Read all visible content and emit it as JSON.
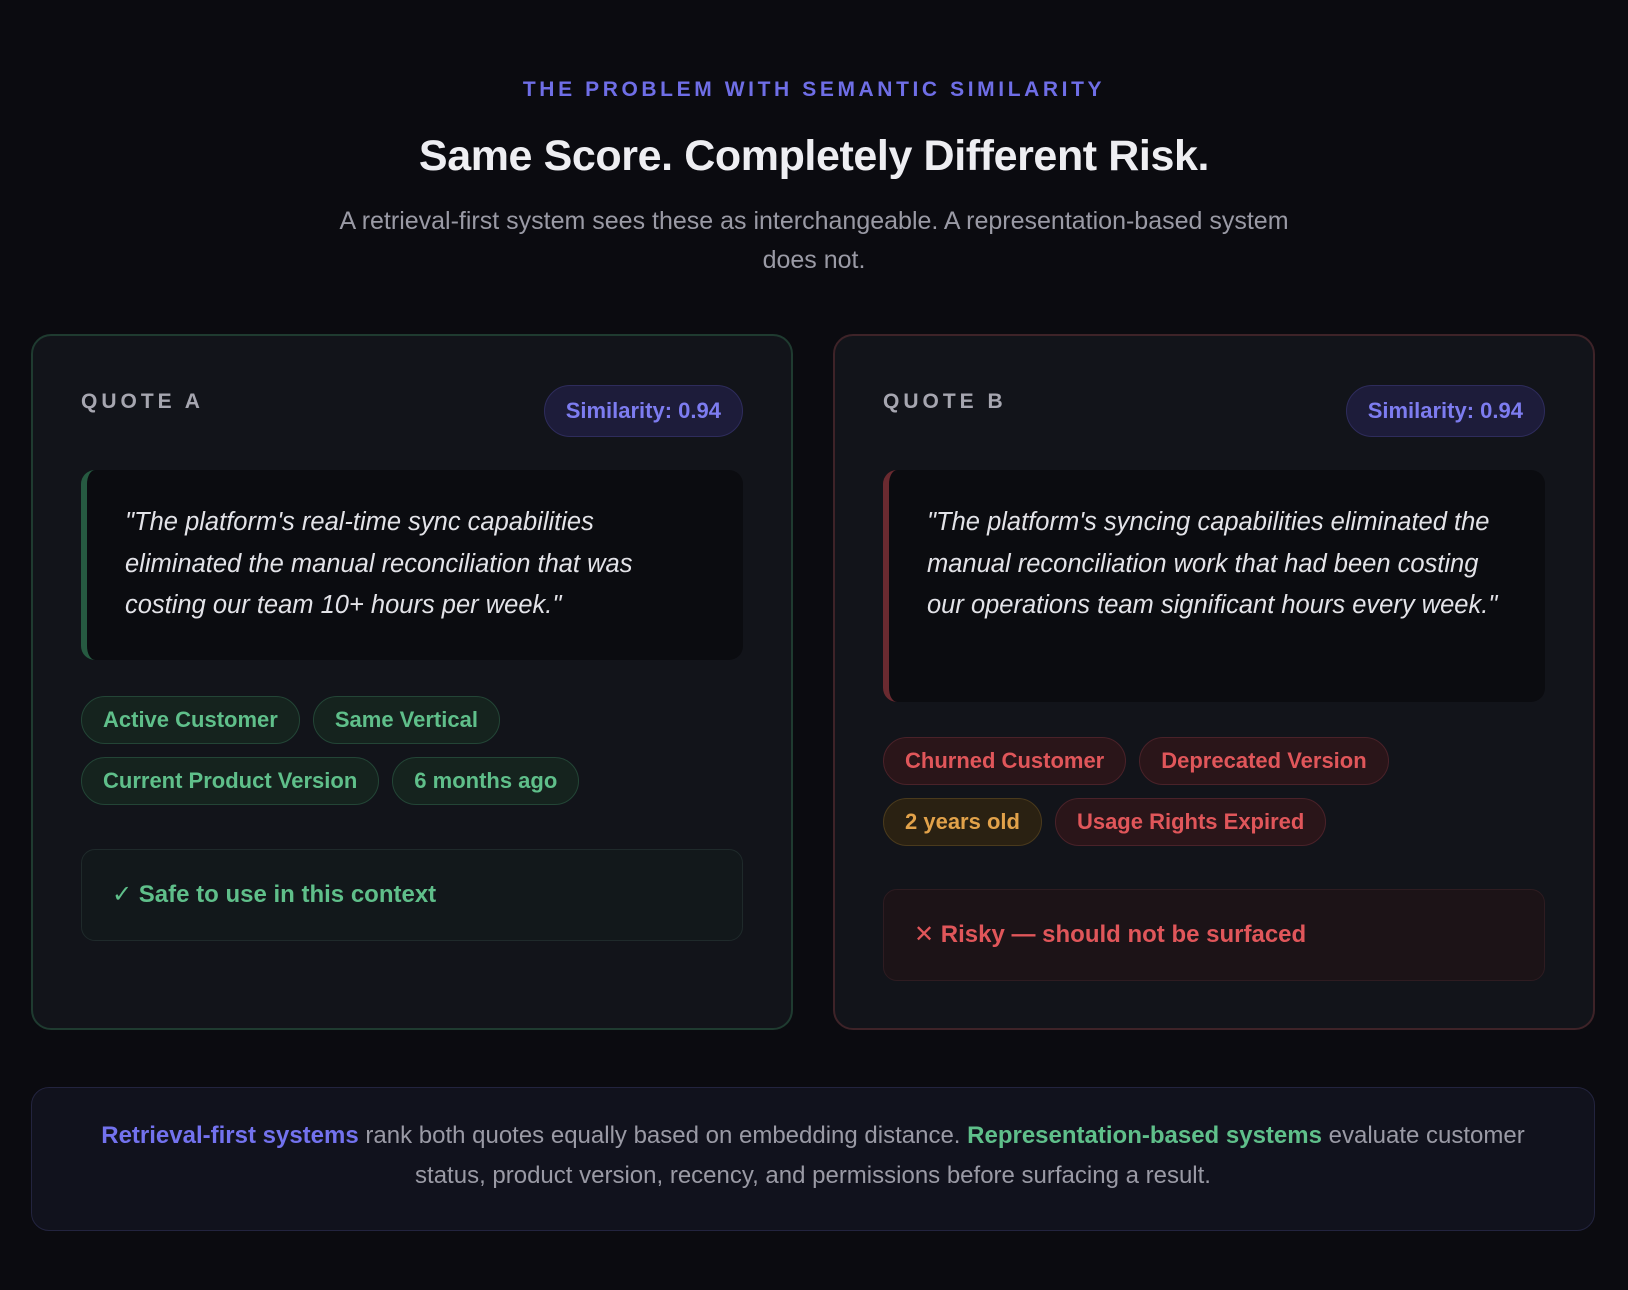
{
  "header": {
    "eyebrow": "THE PROBLEM WITH SEMANTIC SIMILARITY",
    "title": "Same Score. Completely Different Risk.",
    "subtitle": "A retrieval-first system sees these as interchangeable. A representation-based system does not."
  },
  "cards": [
    {
      "label": "QUOTE A",
      "similarity": "Similarity: 0.94",
      "quote": "\"The platform's real-time sync capabilities eliminated the manual reconciliation that was costing our team 10+ hours per week.\"",
      "tags": [
        {
          "text": "Active Customer",
          "tone": "green"
        },
        {
          "text": "Same Vertical",
          "tone": "green"
        },
        {
          "text": "Current Product Version",
          "tone": "green"
        },
        {
          "text": "6 months ago",
          "tone": "green"
        }
      ],
      "verdict": "✓ Safe to use in this context"
    },
    {
      "label": "QUOTE B",
      "similarity": "Similarity: 0.94",
      "quote": "\"The platform's syncing capabilities eliminated the manual reconciliation work that had been costing our operations team significant hours every week.\"",
      "tags": [
        {
          "text": "Churned Customer",
          "tone": "red"
        },
        {
          "text": "Deprecated Version",
          "tone": "red"
        },
        {
          "text": "2 years old",
          "tone": "amber"
        },
        {
          "text": "Usage Rights Expired",
          "tone": "red"
        }
      ],
      "verdict": "✕ Risky — should not be surfaced"
    }
  ],
  "footer": {
    "retrieval_label": "Retrieval-first systems",
    "middle_text": " rank both quotes equally based on embedding distance. ",
    "representation_label": "Representation-based systems",
    "end_text": " evaluate customer status, product version, recency, and permissions before surfacing a result."
  },
  "colors": {
    "accent_blue": "#6f6ee6",
    "safe_green": "#5fbf8a",
    "risk_red": "#e0565a",
    "warn_amber": "#e2a24a",
    "background": "#0b0b10"
  }
}
